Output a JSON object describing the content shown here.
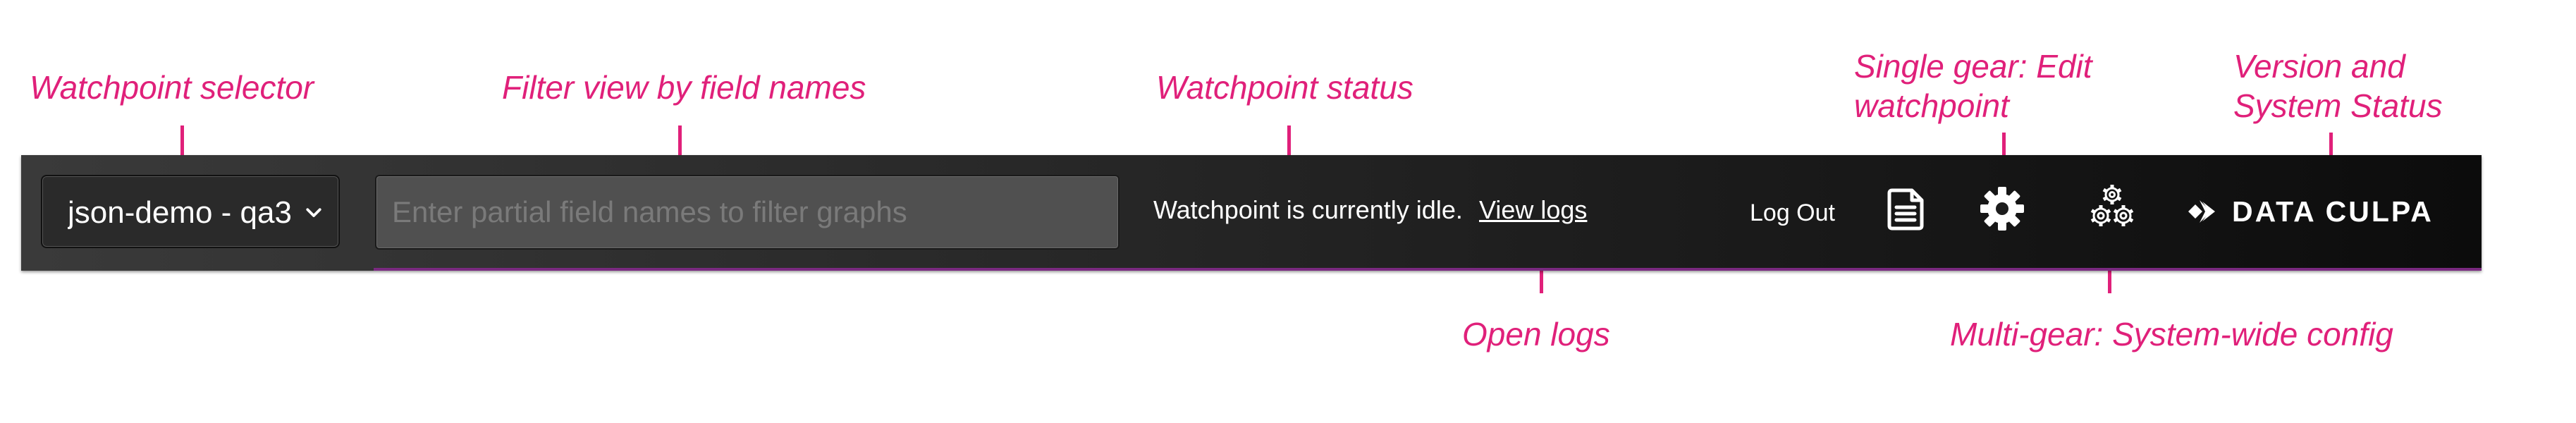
{
  "annotations": {
    "watchpoint_selector": "Watchpoint selector",
    "filter_view": "Filter view by field names",
    "watchpoint_status": "Watchpoint status",
    "single_gear_line1": "Single gear: Edit",
    "single_gear_line2": "watchpoint",
    "version_line1": "Version and",
    "version_line2": "System Status",
    "open_logs": "Open logs",
    "multi_gear": "Multi-gear: System-wide config"
  },
  "toolbar": {
    "selector_value": "json-demo - qa3",
    "filter_placeholder": "Enter partial field names to filter graphs",
    "status_text": "Watchpoint is currently idle.",
    "view_logs_label": "View logs",
    "logout_label": "Log Out",
    "logo_text": "DATA CULPA"
  },
  "icons": {
    "selector_chevron": "chevron-down-icon",
    "logs": "document-icon",
    "single_gear": "gear-icon",
    "multi_gear": "multi-gear-icon",
    "logo_mark": "data-culpa-logo-mark"
  },
  "colors": {
    "annotation": "#e0207a",
    "toolbar_dark": "#0c0c0c",
    "toolbar_light": "#3a3a3a",
    "text": "#ffffff",
    "accent_underline": "#7a2a80"
  }
}
